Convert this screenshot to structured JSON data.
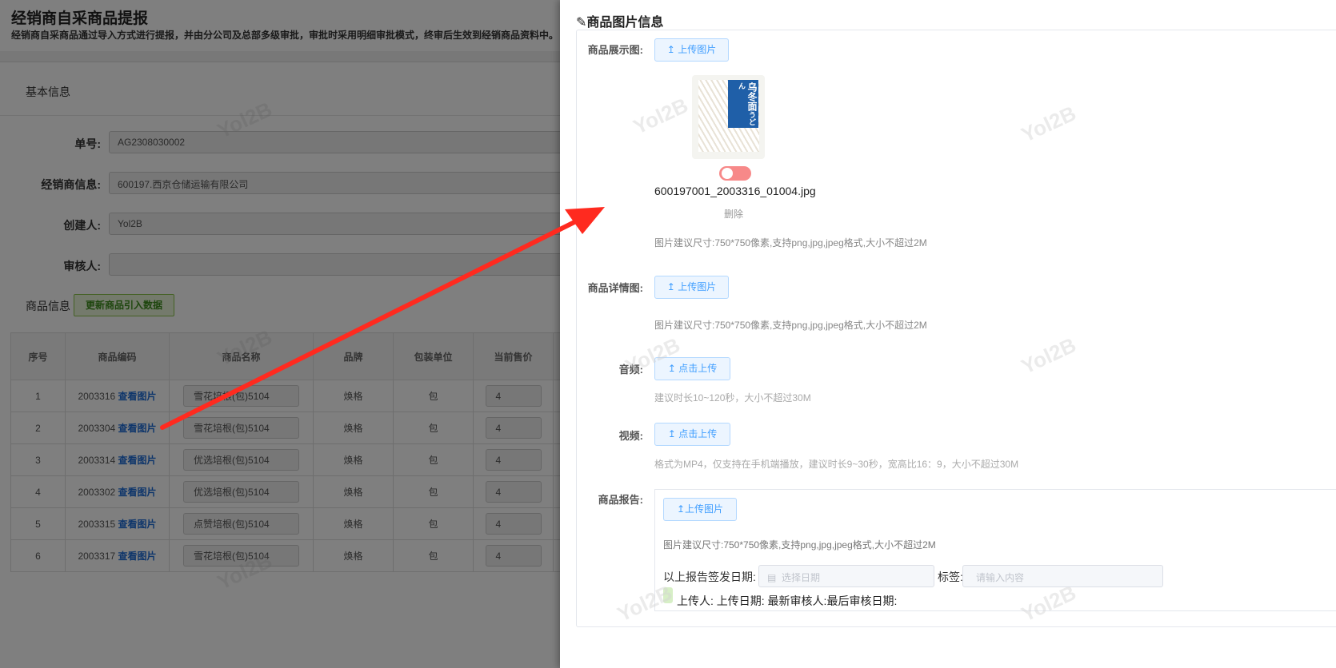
{
  "page": {
    "title": "经销商自采商品提报",
    "subtitle": "经销商自采商品通过导入方式进行提报，并由分公司及总部多级审批，审批时采用明细审批模式，终审后生效到经销商品资料中。"
  },
  "basic": {
    "section": "基本信息",
    "fields": [
      {
        "label": "单号:",
        "value": "AG2308030002"
      },
      {
        "label": "经销商信息:",
        "value": "600197.西京仓储运输有限公司"
      },
      {
        "label": "创建人:",
        "value": "Yol2B"
      },
      {
        "label": "审核人:",
        "value": ""
      }
    ]
  },
  "goods": {
    "section": "商品信息",
    "update_button": "更新商品引入数据",
    "columns": [
      "序号",
      "商品编码",
      "商品名称",
      "品牌",
      "包装单位",
      "当前售价"
    ],
    "link_label": "查看图片",
    "rows": [
      {
        "no": "1",
        "code": "2003316",
        "name": "雪花培根(包)5104",
        "brand": "焕格",
        "unit": "包",
        "price": "4"
      },
      {
        "no": "2",
        "code": "2003304",
        "name": "雪花培根(包)5104",
        "brand": "焕格",
        "unit": "包",
        "price": "4"
      },
      {
        "no": "3",
        "code": "2003314",
        "name": "优选培根(包)5104",
        "brand": "焕格",
        "unit": "包",
        "price": "4"
      },
      {
        "no": "4",
        "code": "2003302",
        "name": "优选培根(包)5104",
        "brand": "焕格",
        "unit": "包",
        "price": "4"
      },
      {
        "no": "5",
        "code": "2003315",
        "name": "点赞培根(包)5104",
        "brand": "焕格",
        "unit": "包",
        "price": "4"
      },
      {
        "no": "6",
        "code": "2003317",
        "name": "雪花培根(包)5104",
        "brand": "焕格",
        "unit": "包",
        "price": "4"
      }
    ]
  },
  "watermark": "Yol2B",
  "panel": {
    "title": "商品图片信息",
    "display": {
      "label": "商品展示图:",
      "button": "上传图片",
      "filename": "600197001_2003316_01004.jpg",
      "delete": "删除",
      "hint": "图片建议尺寸:750*750像素,支持png,jpg,jpeg格式,大小不超过2M",
      "toggle_on": false,
      "product_logo": {
        "main": "乌冬面",
        "kana": "うどん"
      }
    },
    "detail": {
      "label": "商品详情图:",
      "button": "上传图片",
      "hint": "图片建议尺寸:750*750像素,支持png,jpg,jpeg格式,大小不超过2M"
    },
    "audio": {
      "label": "音频:",
      "button": "点击上传",
      "hint": "建议时长10~120秒，大小不超过30M"
    },
    "video": {
      "label": "视频:",
      "button": "点击上传",
      "hint": "格式为MP4，仅支持在手机端播放，建议时长9~30秒，宽高比16：9，大小不超过30M"
    },
    "report": {
      "label": "商品报告:",
      "button": "上传图片",
      "hint": "图片建议尺寸:750*750像素,支持png,jpg,jpeg格式,大小不超过2M",
      "date_label": "以上报告签发日期:",
      "date_placeholder": "选择日期",
      "tag_label": "标签:",
      "tag_placeholder": "请输入内容",
      "meta": "上传人: 上传日期: 最新审核人:最后审核日期:"
    }
  },
  "colors": {
    "arrow": "#ff2a1f",
    "primary": "#409eff",
    "link": "#1e6cd6"
  }
}
